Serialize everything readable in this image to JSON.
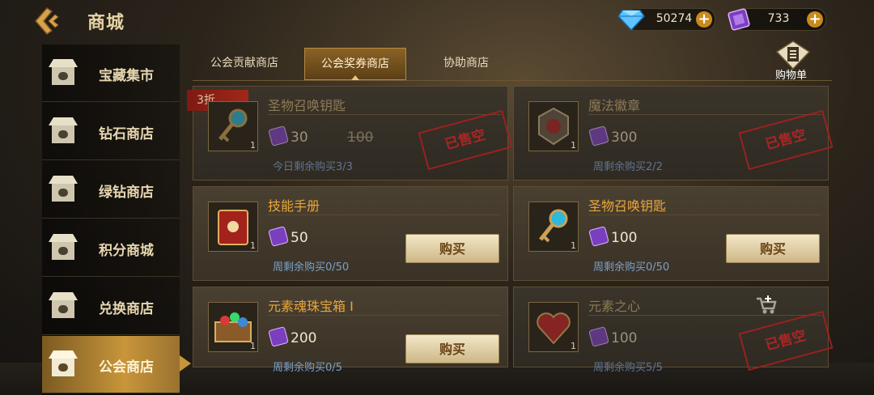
{
  "header": {
    "title": "商城"
  },
  "currencies": [
    {
      "name": "diamond",
      "icon": "diamond-icon",
      "value": "50274"
    },
    {
      "name": "guild-ticket",
      "icon": "ticket-icon",
      "value": "733"
    }
  ],
  "nav": {
    "items": [
      {
        "label": "宝藏集市",
        "icon": "shop-icon"
      },
      {
        "label": "钻石商店",
        "icon": "shop-icon"
      },
      {
        "label": "绿钻商店",
        "icon": "shop-icon"
      },
      {
        "label": "积分商城",
        "icon": "shop-icon"
      },
      {
        "label": "兑换商店",
        "icon": "shop-icon"
      },
      {
        "label": "公会商店",
        "icon": "shop-icon",
        "active": true
      }
    ]
  },
  "tabs": [
    {
      "label": "公会贡献商店"
    },
    {
      "label": "公会奖券商店",
      "active": true
    },
    {
      "label": "协助商店"
    }
  ],
  "cart": {
    "label": "购物单"
  },
  "items": [
    {
      "name": "圣物召唤钥匙",
      "qty": "1",
      "price": "30",
      "old_price": "100",
      "discount": "3折",
      "limit": "今日剩余购买3/3",
      "sold_out": true,
      "stamp": "已售空"
    },
    {
      "name": "魔法徽章",
      "qty": "1",
      "price": "300",
      "limit": "周剩余购买2/2",
      "sold_out": true,
      "stamp": "已售空"
    },
    {
      "name": "技能手册",
      "qty": "1",
      "price": "50",
      "limit": "周剩余购买0/50",
      "buy_label": "购买"
    },
    {
      "name": "圣物召唤钥匙",
      "qty": "1",
      "price": "100",
      "limit": "周剩余购买0/50",
      "buy_label": "购买"
    },
    {
      "name": "元素魂珠宝箱 I",
      "qty": "1",
      "price": "200",
      "limit": "周剩余购买0/5",
      "buy_label": "购买"
    },
    {
      "name": "元素之心",
      "qty": "1",
      "price": "100",
      "limit": "周剩余购买5/5",
      "sold_out": true,
      "stamp": "已售空"
    }
  ],
  "colors": {
    "accent": "#c8953a",
    "price_title": "#e8a63b",
    "limit_text": "#7ba0c8",
    "stamp": "#b52626"
  }
}
